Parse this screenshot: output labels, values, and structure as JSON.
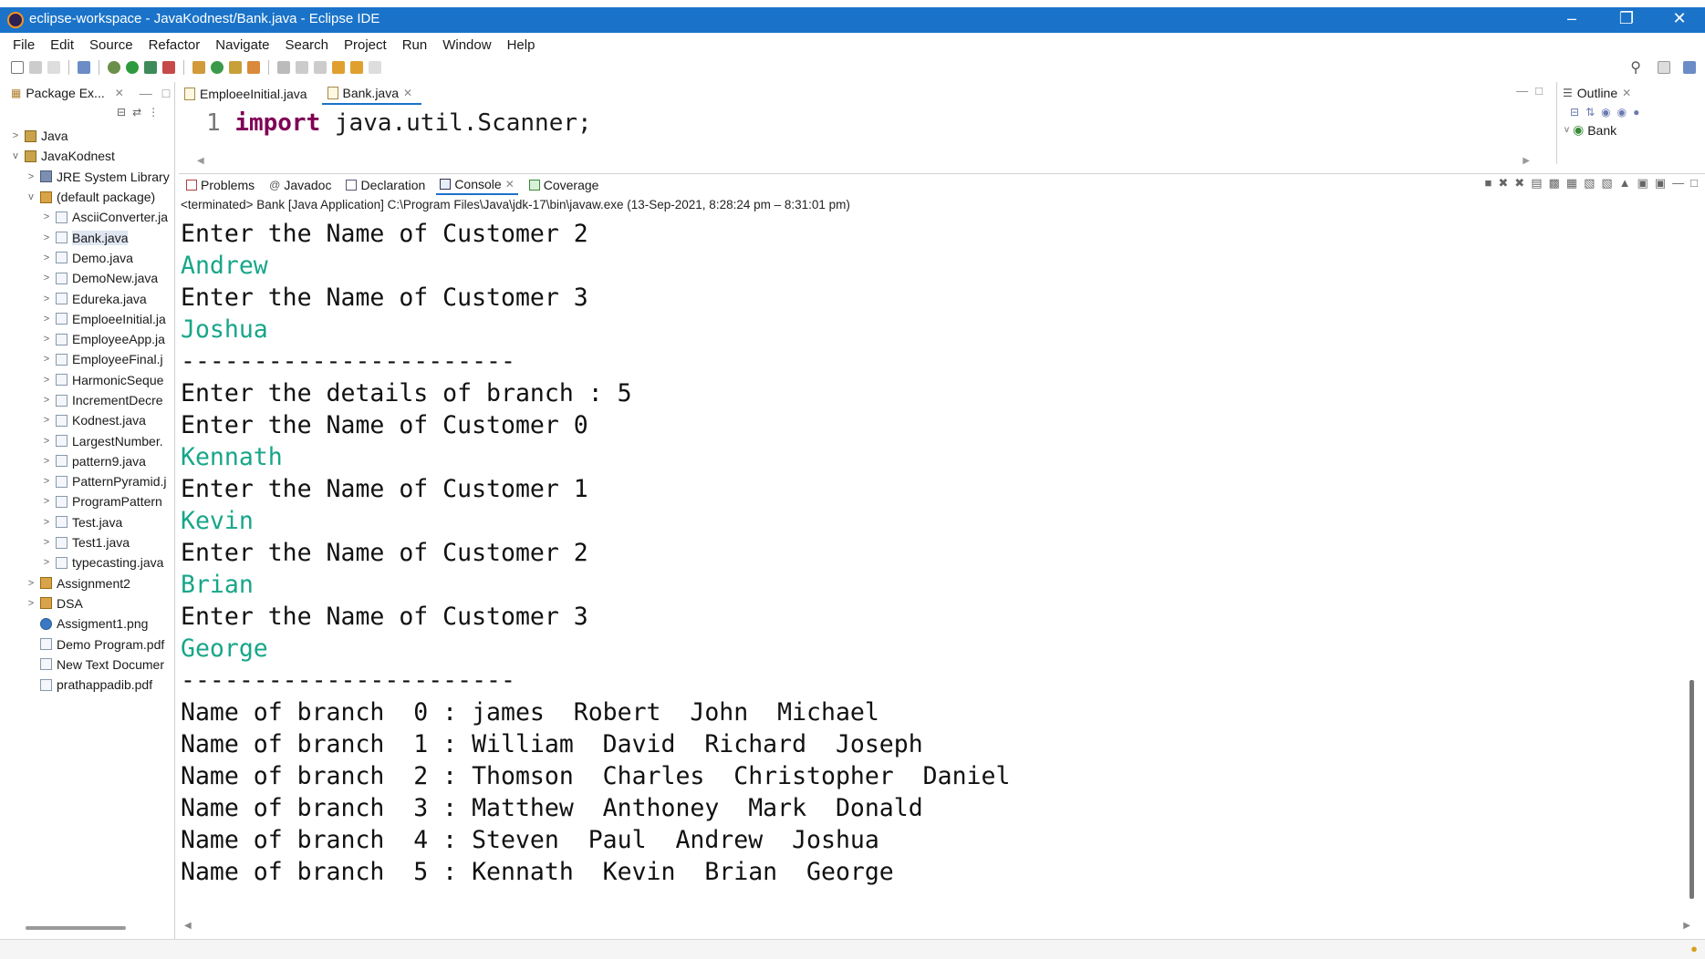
{
  "window": {
    "title": "eclipse-workspace - JavaKodnest/Bank.java - Eclipse IDE",
    "minimize": "–",
    "restore": "❐",
    "close": "✕"
  },
  "menu": [
    "File",
    "Edit",
    "Source",
    "Refactor",
    "Navigate",
    "Search",
    "Project",
    "Run",
    "Window",
    "Help"
  ],
  "package_explorer": {
    "tab_label": "Package Ex...",
    "items": [
      {
        "label": "Java",
        "indent": 0,
        "arrow": ">",
        "icon": "proj"
      },
      {
        "label": "JavaKodnest",
        "indent": 0,
        "arrow": "v",
        "icon": "proj"
      },
      {
        "label": "JRE System Library",
        "indent": 1,
        "arrow": ">",
        "icon": "lib"
      },
      {
        "label": "(default package)",
        "indent": 1,
        "arrow": "v",
        "icon": "pkg"
      },
      {
        "label": "AsciiConverter.ja",
        "indent": 2,
        "arrow": ">",
        "icon": "java"
      },
      {
        "label": "Bank.java",
        "indent": 2,
        "arrow": ">",
        "icon": "java",
        "selected": true
      },
      {
        "label": "Demo.java",
        "indent": 2,
        "arrow": ">",
        "icon": "java"
      },
      {
        "label": "DemoNew.java",
        "indent": 2,
        "arrow": ">",
        "icon": "java"
      },
      {
        "label": "Edureka.java",
        "indent": 2,
        "arrow": ">",
        "icon": "java"
      },
      {
        "label": "EmploeeInitial.ja",
        "indent": 2,
        "arrow": ">",
        "icon": "java"
      },
      {
        "label": "EmployeeApp.ja",
        "indent": 2,
        "arrow": ">",
        "icon": "java"
      },
      {
        "label": "EmployeeFinal.j",
        "indent": 2,
        "arrow": ">",
        "icon": "java"
      },
      {
        "label": "HarmonicSeque",
        "indent": 2,
        "arrow": ">",
        "icon": "java"
      },
      {
        "label": "IncrementDecre",
        "indent": 2,
        "arrow": ">",
        "icon": "java"
      },
      {
        "label": "Kodnest.java",
        "indent": 2,
        "arrow": ">",
        "icon": "java"
      },
      {
        "label": "LargestNumber.",
        "indent": 2,
        "arrow": ">",
        "icon": "java"
      },
      {
        "label": "pattern9.java",
        "indent": 2,
        "arrow": ">",
        "icon": "java"
      },
      {
        "label": "PatternPyramid.j",
        "indent": 2,
        "arrow": ">",
        "icon": "java"
      },
      {
        "label": "ProgramPattern",
        "indent": 2,
        "arrow": ">",
        "icon": "java"
      },
      {
        "label": "Test.java",
        "indent": 2,
        "arrow": ">",
        "icon": "java"
      },
      {
        "label": "Test1.java",
        "indent": 2,
        "arrow": ">",
        "icon": "java"
      },
      {
        "label": "typecasting.java",
        "indent": 2,
        "arrow": ">",
        "icon": "java"
      },
      {
        "label": "Assignment2",
        "indent": 1,
        "arrow": ">",
        "icon": "pkg"
      },
      {
        "label": "DSA",
        "indent": 1,
        "arrow": ">",
        "icon": "pkg"
      },
      {
        "label": "Assigment1.png",
        "indent": 1,
        "arrow": "",
        "icon": "png"
      },
      {
        "label": "Demo Program.pdf",
        "indent": 1,
        "arrow": "",
        "icon": "file"
      },
      {
        "label": "New Text Documer",
        "indent": 1,
        "arrow": "",
        "icon": "file"
      },
      {
        "label": "prathappadib.pdf",
        "indent": 1,
        "arrow": "",
        "icon": "file"
      }
    ]
  },
  "editor": {
    "tabs": [
      {
        "label": "EmploeeInitial.java",
        "active": false
      },
      {
        "label": "Bank.java",
        "active": true
      }
    ],
    "line_number": "1",
    "keyword": "import",
    "code_rest": " java.util.Scanner;"
  },
  "outline": {
    "tab_label": "Outline",
    "item": "Bank"
  },
  "console": {
    "tabs": [
      {
        "label": "Problems",
        "active": false
      },
      {
        "label": "Javadoc",
        "active": false
      },
      {
        "label": "Declaration",
        "active": false
      },
      {
        "label": "Console",
        "active": true
      },
      {
        "label": "Coverage",
        "active": false
      }
    ],
    "status": "<terminated> Bank [Java Application] C:\\Program Files\\Java\\jdk-17\\bin\\javaw.exe  (13-Sep-2021, 8:28:24 pm – 8:31:01 pm)",
    "lines": [
      {
        "text": "Enter the Name of Customer 2",
        "kind": "out"
      },
      {
        "text": "Andrew",
        "kind": "inp"
      },
      {
        "text": "Enter the Name of Customer 3",
        "kind": "out"
      },
      {
        "text": "Joshua",
        "kind": "inp"
      },
      {
        "text": "-----------------------",
        "kind": "out"
      },
      {
        "text": "Enter the details of branch : 5",
        "kind": "out"
      },
      {
        "text": "Enter the Name of Customer 0",
        "kind": "out"
      },
      {
        "text": "Kennath",
        "kind": "inp"
      },
      {
        "text": "Enter the Name of Customer 1",
        "kind": "out"
      },
      {
        "text": "Kevin",
        "kind": "inp"
      },
      {
        "text": "Enter the Name of Customer 2",
        "kind": "out"
      },
      {
        "text": "Brian",
        "kind": "inp"
      },
      {
        "text": "Enter the Name of Customer 3",
        "kind": "out"
      },
      {
        "text": "George",
        "kind": "inp"
      },
      {
        "text": "-----------------------",
        "kind": "out"
      },
      {
        "text": "Name of branch  0 : james  Robert  John  Michael",
        "kind": "out"
      },
      {
        "text": "Name of branch  1 : William  David  Richard  Joseph",
        "kind": "out"
      },
      {
        "text": "Name of branch  2 : Thomson  Charles  Christopher  Daniel",
        "kind": "out"
      },
      {
        "text": "Name of branch  3 : Matthew  Anthoney  Mark  Donald",
        "kind": "out"
      },
      {
        "text": "Name of branch  4 : Steven  Paul  Andrew  Joshua",
        "kind": "out"
      },
      {
        "text": "Name of branch  5 : Kennath  Kevin  Brian  George",
        "kind": "out"
      }
    ]
  },
  "colors": {
    "title_bar": "#1a73c9",
    "input_text": "#17a689",
    "keyword": "#7f0055"
  }
}
